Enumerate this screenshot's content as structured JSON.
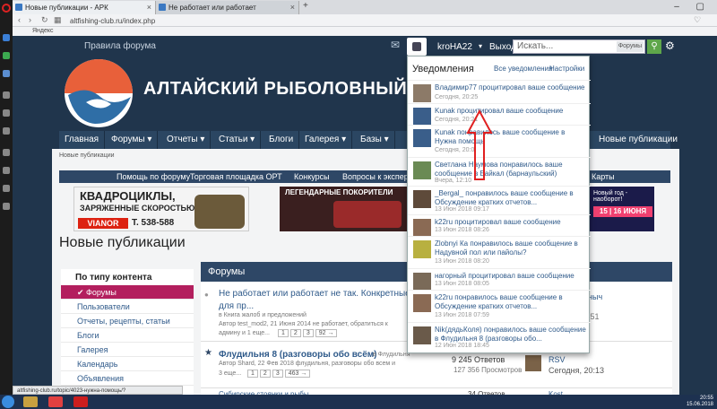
{
  "browser": {
    "tabs": [
      {
        "label": "Новые публикации - АРК"
      },
      {
        "label": "Не работает или работает"
      }
    ],
    "url": "altfishing-club.ru/index.php",
    "bookmark": "Яндекс",
    "window_controls": "– ▢ ✕",
    "status_link": "altfishing-club.ru/topic/4023-нужна-помощь/?view=findpost&p=509778"
  },
  "header": {
    "rules": "Правила форума",
    "username": "kroHA22",
    "logout": "Выход",
    "search_placeholder": "Искать...",
    "search_scope": "Форумы",
    "site_title": "АЛТАЙСКИЙ РЫБОЛОВНЫЙ КЛ"
  },
  "main_menu": [
    {
      "label": "Главная"
    },
    {
      "label": "Форумы ▾"
    },
    {
      "label": "Отчеты ▾"
    },
    {
      "label": "Статьи ▾"
    },
    {
      "label": "Блоги"
    },
    {
      "label": "Галерея ▾"
    },
    {
      "label": "Базы ▾"
    },
    {
      "label": "Новые публикации"
    }
  ],
  "breadcrumb": "Новые публикации",
  "sub_menu": [
    {
      "label": "Помощь по форуму"
    },
    {
      "label": "Торговая площадка ОРТ"
    },
    {
      "label": "Конкурсы"
    },
    {
      "label": "Вопросы к экспертам"
    },
    {
      "label": "Карты"
    }
  ],
  "ads": {
    "ad1_line1": "КВАДРОЦИКЛЫ,",
    "ad1_line2": "ЗАРЯЖЕННЫЕ СКОРОСТЬЮ",
    "ad1_brand": "VIANOR",
    "ad1_phone": "Т. 538-588",
    "ad2_text": "ЛЕГЕНДАРНЫЕ ПОКОРИТЕЛИ",
    "ad3_line1": "Новый год - наоборот!",
    "ad3_line2": "15 | 16 ИЮНЯ"
  },
  "page_title": "Новые публикации",
  "filter": {
    "heading": "По типу контента",
    "items": [
      {
        "label": "Форумы"
      },
      {
        "label": "Пользователи"
      },
      {
        "label": "Отчеты, рецепты, статьи"
      },
      {
        "label": "Блоги"
      },
      {
        "label": "Галерея"
      },
      {
        "label": "Календарь"
      },
      {
        "label": "Объявления"
      }
    ]
  },
  "forum": {
    "heading": "Форумы",
    "topic1_title": "Не работает или работает не так. Конкретные фак",
    "topic1_title2": "для пр...",
    "topic1_meta1": "в Книга жалоб и предложений",
    "topic1_meta2": "Автор test_mod2, 21 Июня 2014  не работает, обратиться к",
    "topic1_meta3": "админу и 1 еще...",
    "topic1_pages": [
      "1",
      "2",
      "3",
      "92 →"
    ],
    "topic1_side": "ныч",
    "topic1_side2": ":51",
    "topic2_title": "Флудильня 8 (разговоры обо всём)",
    "topic2_forum": "в Флудильня",
    "topic2_meta": "Автор Shard, 22 Фев 2018  флудильня, разговоры обо всем и",
    "topic2_meta2": "3 еще...",
    "topic2_pages": [
      "1",
      "2",
      "3",
      "463 →"
    ],
    "topic2_replies": "9 245 Ответов",
    "topic2_views": "127 356 Просмотров",
    "topic2_last_user": "RSV",
    "topic2_last_time": "Сегодня, 20:13",
    "next_replies": "34 Ответов",
    "next_user": "Kost...",
    "next_title": "Сибирские стоянки и рыбы"
  },
  "notifications": {
    "title": "Уведомления",
    "all": "Все уведомления",
    "settings": "Настройки",
    "items": [
      {
        "text": "Владимир77 процитировал ваше сообщение",
        "time": "Сегодня, 20:25"
      },
      {
        "text": "Kunak процитировал ваше сообщение",
        "time": "Сегодня, 20:21"
      },
      {
        "text": "Kunak понравилось ваше сообщение в Нужна помощь",
        "time": "Сегодня, 20:0"
      },
      {
        "text": "Светлана Наумова понравилось ваше сообщение в Байкал (барнаульский)",
        "time": "Вчера, 12:10"
      },
      {
        "text": "_Bergal_ понравилось ваше сообщение в Обсуждение кратких отчетов...",
        "time": "13 Июн 2018 09:17"
      },
      {
        "text": "k22ru процитировал ваше сообщение",
        "time": "13 Июн 2018 08:26"
      },
      {
        "text": "Zlobnyi Ка понравилось ваше сообщение в Надувной пол или пайолы?",
        "time": "13 Июн 2018 08:20"
      },
      {
        "text": "нагорный процитировал ваше сообщение",
        "time": "13 Июн 2018 08:05"
      },
      {
        "text": "k22ru понравилось ваше сообщение в Обсуждение кратких отчетов...",
        "time": "13 Июн 2018 07:59"
      },
      {
        "text": "Nik(дядьКоля) понравилось ваше сообщение в Флудильня 8 (разговоры обо...",
        "time": "12 Июн 2018 18:45"
      }
    ]
  },
  "taskbar": {
    "time": "20:55",
    "date": "15.06.2018"
  },
  "colors": {
    "site_bg": "#20354c",
    "active_filter": "#b31f5e",
    "arrow": "#e02020"
  }
}
